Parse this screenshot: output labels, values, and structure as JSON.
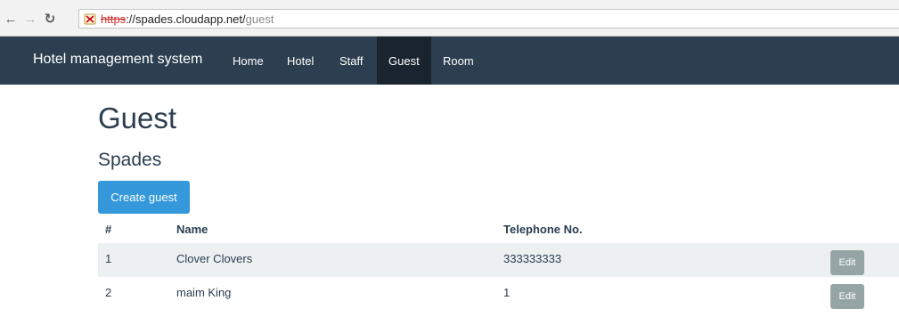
{
  "browser": {
    "nav_icons": [
      "back-arrow-icon",
      "forward-arrow-icon",
      "reload-icon"
    ],
    "url": {
      "scheme": "https",
      "rest": "://spades.cloudapp.net/",
      "path": "guest"
    }
  },
  "navbar": {
    "brand": "Hotel management system",
    "links": [
      {
        "label": "Home",
        "active": false
      },
      {
        "label": "Hotel",
        "active": false
      },
      {
        "label": "Staff",
        "active": false
      },
      {
        "label": "Guest",
        "active": true
      },
      {
        "label": "Room",
        "active": false
      }
    ]
  },
  "main": {
    "title": "Guest",
    "subtitle": "Spades",
    "create_button": "Create guest",
    "table": {
      "headers": {
        "num": "#",
        "name": "Name",
        "telephone": "Telephone No."
      },
      "rows": [
        {
          "num": "1",
          "name": "Clover Clovers",
          "telephone": "333333333",
          "action": "Edit"
        },
        {
          "num": "2",
          "name": "maim King",
          "telephone": "1",
          "action": "Edit"
        }
      ]
    }
  },
  "colors": {
    "navbar_bg": "#2c3e50",
    "navbar_active": "#1a242f",
    "primary": "#3498db",
    "row_stripe": "#ecf0f1",
    "edit_button": "#95a5a6",
    "insecure_scheme": "#c9302c"
  }
}
